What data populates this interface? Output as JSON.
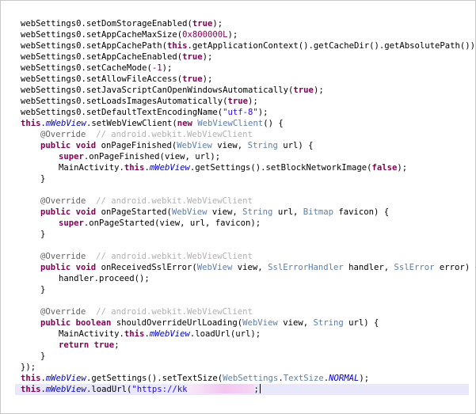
{
  "code": {
    "lines": [
      "webSettings0.setDomStorageEnabled(true);",
      "webSettings0.setAppCacheMaxSize(0x800000L);",
      "webSettings0.setAppCachePath(this.getApplicationContext().getCacheDir().getAbsolutePath());",
      "webSettings0.setAppCacheEnabled(true);",
      "webSettings0.setCacheMode(-1);",
      "webSettings0.setAllowFileAccess(true);",
      "webSettings0.setJavaScriptCanOpenWindowsAutomatically(true);",
      "webSettings0.setLoadsImagesAutomatically(true);",
      "webSettings0.setDefaultTextEncodingName(\"utf-8\");",
      "this.mWebView.setWebViewClient(new WebViewClient() {",
      "@Override  // android.webkit.WebViewClient",
      "public void onPageFinished(WebView view, String url) {",
      "super.onPageFinished(view, url);",
      "MainActivity.this.mWebView.getSettings().setBlockNetworkImage(false);",
      "}",
      "@Override  // android.webkit.WebViewClient",
      "public void onPageStarted(WebView view, String url, Bitmap favicon) {",
      "super.onPageStarted(view, url, favicon);",
      "}",
      "@Override  // android.webkit.WebViewClient",
      "public void onReceivedSslError(WebView view, SslErrorHandler handler, SslError error) {",
      "handler.proceed();",
      "}",
      "@Override  // android.webkit.WebViewClient",
      "public boolean shouldOverrideUrlLoading(WebView view, String url) {",
      "MainActivity.this.mWebView.loadUrl(url);",
      "return true;",
      "}",
      "});",
      "this.mWebView.getSettings().setTextSize(WebSettings.TextSize.NORMAL);",
      "this.mWebView.loadUrl(\"https://kk",
      ";"
    ]
  },
  "colors": {
    "keyword": "#7f0055",
    "string": "#2a00ff",
    "type": "#5c7ea8",
    "annotation": "#646464",
    "comment": "#b0b0b0",
    "field": "#0000c0",
    "current_line": "#e8e8fa"
  }
}
